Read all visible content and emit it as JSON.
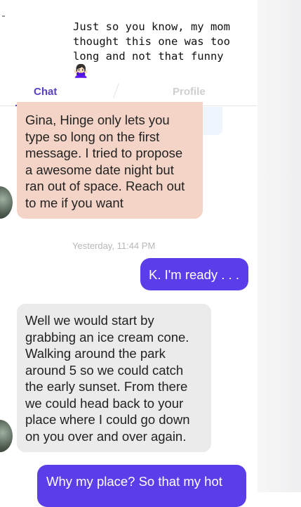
{
  "caption": {
    "lines": [
      "Just so you know, my mom",
      "thought this one was too",
      "long and not that funny"
    ],
    "emoji": "🙅🏻‍♀️"
  },
  "tabs": {
    "chat": "Chat",
    "profile": "Profile",
    "active_color": "#5b3ec8"
  },
  "messages": [
    {
      "from": "them",
      "lines": [
        "Gina, Hinge only lets you",
        "type so long on the first",
        "message. I tried to propose",
        "a awesome date night but",
        "ran out of space. Reach out",
        "to me if you want"
      ],
      "bg": "#f4d4c7"
    },
    {
      "timestamp": "Yesterday, 11:44 PM"
    },
    {
      "from": "me",
      "text": "K. I'm ready . . .",
      "bg": "#5b3dea"
    },
    {
      "from": "them",
      "lines": [
        "Well we would start by",
        "grabbing an ice cream cone.",
        "Walking around the park",
        "around 5 so we could catch",
        "the early sunset. From there",
        "we could head back to your",
        "place where I could go down",
        "on you over and over again."
      ],
      "bg": "#ebebeb"
    },
    {
      "from": "me",
      "text": "Why my place? So that my hot",
      "bg": "#5b3dea"
    }
  ]
}
